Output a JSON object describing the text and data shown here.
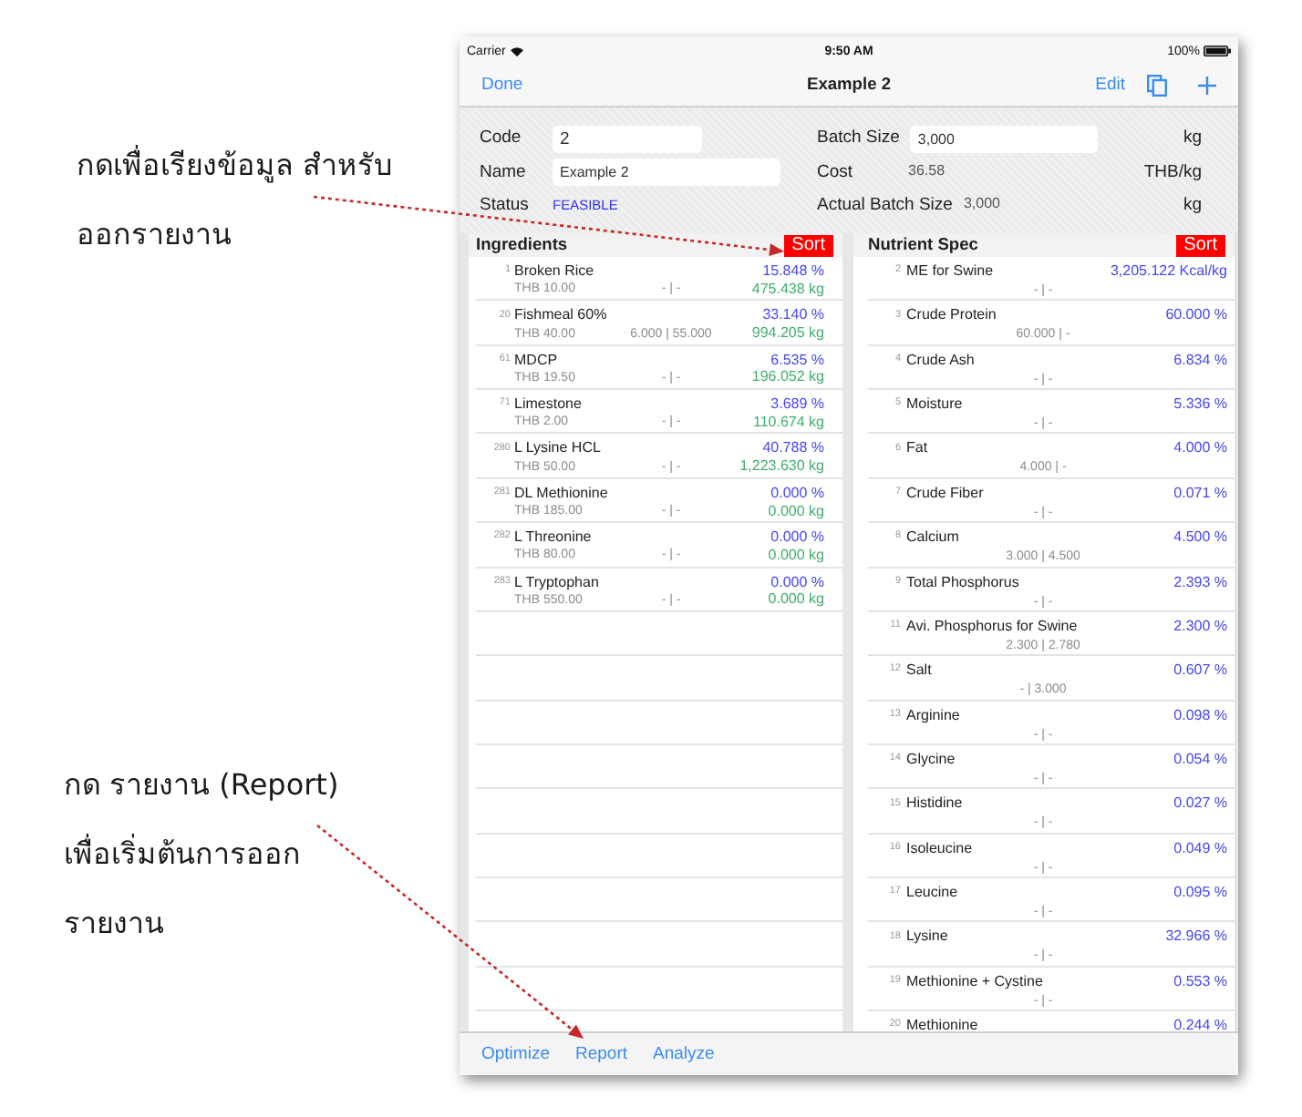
{
  "annotations": [
    {
      "text": "กดเพื่อเรียงข้อมูล สำหรับ\nออกรายงาน"
    },
    {
      "text": "กด รายงาน (Report)\nเพื่อเริ่มต้นการออก\nรายงาน"
    }
  ],
  "status_bar": {
    "carrier": "Carrier",
    "time": "9:50 AM",
    "battery": "100%"
  },
  "nav_bar": {
    "left_button": "Done",
    "title": "Example 2",
    "right_button": "Edit"
  },
  "form": {
    "left": [
      {
        "kind": "input",
        "label": "Code",
        "value": "2"
      },
      {
        "kind": "input",
        "label": "Name",
        "value": "Example 2"
      },
      {
        "kind": "status",
        "label": "Status",
        "value": "FEASIBLE"
      }
    ],
    "right": [
      {
        "kind": "input",
        "label": "Batch Size",
        "value": "3,000",
        "unit": "kg"
      },
      {
        "kind": "text",
        "label": "Cost",
        "value": "36.58",
        "unit": "THB/kg"
      },
      {
        "kind": "text",
        "label": "Actual Batch Size",
        "value": "3,000",
        "unit": "kg"
      }
    ]
  },
  "ingredients": {
    "title": "Ingredients",
    "sort_button": "Sort",
    "rows": [
      {
        "number": "1",
        "name": "Broken Rice",
        "price": "THB 10.00",
        "limits": "- | -",
        "percent": "15.848 %",
        "amount": "475.438 kg"
      },
      {
        "number": "20",
        "name": "Fishmeal 60%",
        "price": "THB 40.00",
        "limits": "6.000 | 55.000",
        "percent": "33.140 %",
        "amount": "994.205 kg"
      },
      {
        "number": "61",
        "name": "MDCP",
        "price": "THB 19.50",
        "limits": "- | -",
        "percent": "6.535 %",
        "amount": "196.052 kg"
      },
      {
        "number": "71",
        "name": "Limestone",
        "price": "THB 2.00",
        "limits": "- | -",
        "percent": "3.689 %",
        "amount": "110.674 kg"
      },
      {
        "number": "280",
        "name": "L Lysine HCL",
        "price": "THB 50.00",
        "limits": "- | -",
        "percent": "40.788 %",
        "amount": "1,223.630 kg"
      },
      {
        "number": "281",
        "name": "DL Methionine",
        "price": "THB 185.00",
        "limits": "- | -",
        "percent": "0.000 %",
        "amount": "0.000 kg"
      },
      {
        "number": "282",
        "name": "L Threonine",
        "price": "THB 80.00",
        "limits": "- | -",
        "percent": "0.000 %",
        "amount": "0.000 kg"
      },
      {
        "number": "283",
        "name": "L Tryptophan",
        "price": "THB 550.00",
        "limits": "- | -",
        "percent": "0.000 %",
        "amount": "0.000 kg"
      }
    ]
  },
  "nutrient_spec": {
    "title": "Nutrient Spec",
    "sort_button": "Sort",
    "rows": [
      {
        "number": "2",
        "name": "ME for Swine",
        "limits": "- | -",
        "value": "3,205.122 Kcal/kg"
      },
      {
        "number": "3",
        "name": "Crude Protein",
        "limits": "60.000 | -",
        "value": "60.000 %"
      },
      {
        "number": "4",
        "name": "Crude Ash",
        "limits": "- | -",
        "value": "6.834 %"
      },
      {
        "number": "5",
        "name": "Moisture",
        "limits": "- | -",
        "value": "5.336 %"
      },
      {
        "number": "6",
        "name": "Fat",
        "limits": "4.000 | -",
        "value": "4.000 %"
      },
      {
        "number": "7",
        "name": "Crude Fiber",
        "limits": "- | -",
        "value": "0.071 %"
      },
      {
        "number": "8",
        "name": "Calcium",
        "limits": "3.000 | 4.500",
        "value": "4.500 %"
      },
      {
        "number": "9",
        "name": "Total Phosphorus",
        "limits": "- | -",
        "value": "2.393 %"
      },
      {
        "number": "11",
        "name": "Avi. Phosphorus for Swine",
        "limits": "2.300 | 2.780",
        "value": "2.300 %"
      },
      {
        "number": "12",
        "name": "Salt",
        "limits": "- | 3.000",
        "value": "0.607 %"
      },
      {
        "number": "13",
        "name": "Arginine",
        "limits": "- | -",
        "value": "0.098 %"
      },
      {
        "number": "14",
        "name": "Glycine",
        "limits": "- | -",
        "value": "0.054 %"
      },
      {
        "number": "15",
        "name": "Histidine",
        "limits": "- | -",
        "value": "0.027 %"
      },
      {
        "number": "16",
        "name": "Isoleucine",
        "limits": "- | -",
        "value": "0.049 %"
      },
      {
        "number": "17",
        "name": "Leucine",
        "limits": "- | -",
        "value": "0.095 %"
      },
      {
        "number": "18",
        "name": "Lysine",
        "limits": "- | -",
        "value": "32.966 %"
      },
      {
        "number": "19",
        "name": "Methionine + Cystine",
        "limits": "- | -",
        "value": "0.553 %"
      },
      {
        "number": "20",
        "name": "Methionine",
        "value": "0.244 %"
      }
    ]
  },
  "toolbar": {
    "items": [
      "Optimize",
      "Report",
      "Analyze"
    ]
  }
}
